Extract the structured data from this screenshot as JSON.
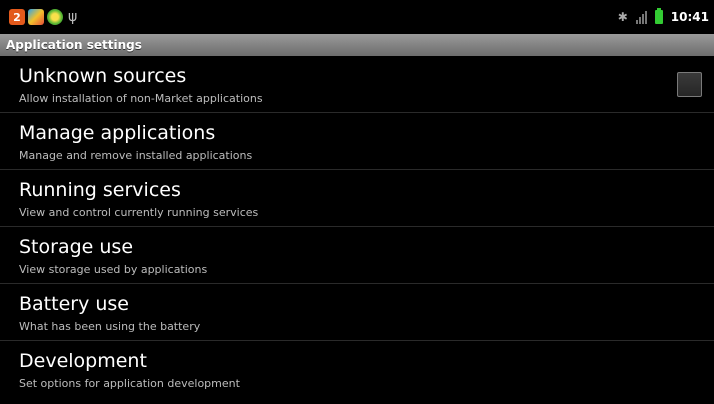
{
  "status_bar": {
    "notifications": [
      {
        "icon": "app-badge-2-icon",
        "text": "2"
      },
      {
        "icon": "colorful-app-icon",
        "text": ""
      },
      {
        "icon": "green-yellow-app-icon",
        "text": ""
      },
      {
        "icon": "usb-icon",
        "text": "ψ"
      }
    ],
    "bluetooth_icon": "bluetooth-icon",
    "signal_icon": "signal-icon",
    "battery_icon": "battery-icon",
    "time": "10:41",
    "colors": {
      "battery": "#33cc33"
    }
  },
  "header": {
    "title": "Application settings"
  },
  "settings": [
    {
      "title": "Unknown sources",
      "summary": "Allow installation of non-Market applications",
      "checkbox": false
    },
    {
      "title": "Manage applications",
      "summary": "Manage and remove installed applications"
    },
    {
      "title": "Running services",
      "summary": "View and control currently running services"
    },
    {
      "title": "Storage use",
      "summary": "View storage used by applications"
    },
    {
      "title": "Battery use",
      "summary": "What has been using the battery"
    },
    {
      "title": "Development",
      "summary": "Set options for application development"
    }
  ]
}
